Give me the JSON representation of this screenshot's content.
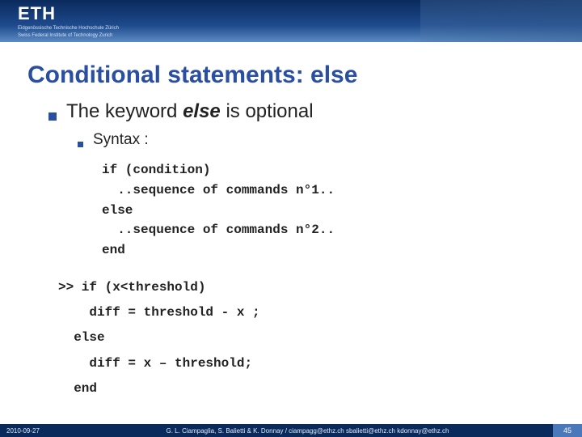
{
  "header": {
    "logo": "ETH",
    "sub1": "Eidgenössische Technische Hochschule Zürich",
    "sub2": "Swiss Federal Institute of Technology Zurich"
  },
  "title": "Conditional statements: else",
  "bullet_main_pre": "The keyword ",
  "bullet_main_kw": "else",
  "bullet_main_post": " is optional",
  "bullet_sub": "Syntax :",
  "code": "if (condition)\n  ..sequence of commands n°1..\nelse\n  ..sequence of commands n°2..\nend",
  "example": ">> if (x<threshold)\n    diff = threshold - x ;\n  else\n    diff = x – threshold;\n  end",
  "footer": {
    "date": "2010-09-27",
    "center": "G. L. Ciampaglia, S. Balietti & K. Donnay /  ciampagg@ethz.ch  sbalietti@ethz.ch  kdonnay@ethz.ch",
    "page": "45"
  }
}
